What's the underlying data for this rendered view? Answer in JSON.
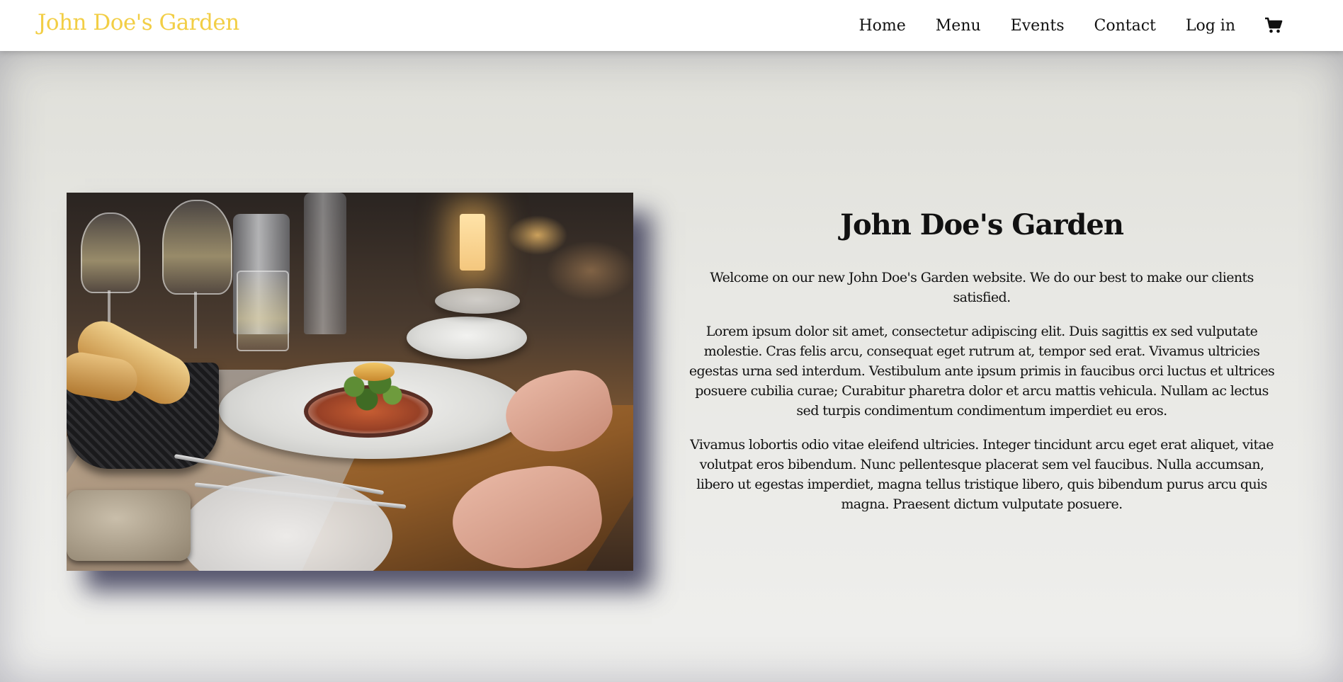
{
  "header": {
    "brand": "John Doe's Garden",
    "brand_color": "#f2ce45",
    "nav": [
      {
        "label": "Home"
      },
      {
        "label": "Menu"
      },
      {
        "label": "Events"
      },
      {
        "label": "Contact"
      },
      {
        "label": "Log in"
      }
    ],
    "cart_icon": "shopping-cart-icon"
  },
  "hero": {
    "image": "restaurant-dinner-table-photo",
    "title": "John Doe's Garden",
    "paragraphs": [
      "Welcome on our new John Doe's Garden website. We do our best to make our clients satisfied.",
      "Lorem ipsum dolor sit amet, consectetur adipiscing elit. Duis sagittis ex sed vulputate molestie. Cras felis arcu, consequat eget rutrum at, tempor sed erat. Vivamus ultricies egestas urna sed interdum. Vestibulum ante ipsum primis in faucibus orci luctus et ultrices posuere cubilia curae; Curabitur pharetra dolor et arcu mattis vehicula. Nullam ac lectus sed turpis condimentum condimentum imperdiet eu eros.",
      "Vivamus lobortis odio vitae eleifend ultricies. Integer tincidunt arcu eget erat aliquet, vitae volutpat eros bibendum. Nunc pellentesque placerat sem vel faucibus. Nulla accumsan, libero ut egestas imperdiet, magna tellus tristique libero, quis bibendum purus arcu quis magna. Praesent dictum vulputate posuere."
    ]
  }
}
